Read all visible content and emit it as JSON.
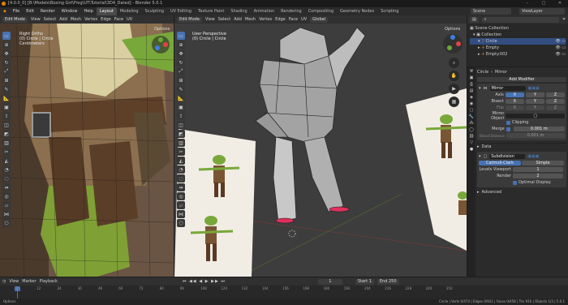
{
  "window": {
    "title": "[4.0.0_0] [B:\\Models\\Boxing Girl\\Frog\\UT\\Tutorial\\3D4_Dated] - Blender 5.0.1",
    "minimize": "–",
    "maximize": "□",
    "close": "✕"
  },
  "menu": [
    "File",
    "Edit",
    "Render",
    "Window",
    "Help"
  ],
  "workspaces": [
    "Layout",
    "Modeling",
    "Sculpting",
    "UV Editing",
    "Texture Paint",
    "Shading",
    "Animation",
    "Rendering",
    "Compositing",
    "Geometry Nodes",
    "Scripting"
  ],
  "active_workspace": "Layout",
  "scene": {
    "label": "Scene",
    "viewlayer": "ViewLayer"
  },
  "left_viewport": {
    "mode": "Edit Mode",
    "menus": [
      "View",
      "Select",
      "Add",
      "Mesh",
      "Vertex",
      "Edge",
      "Face",
      "UV"
    ],
    "overlay_lines": [
      "Right Ortho",
      "(0) Circle | Circle",
      "Centimeters"
    ],
    "options": "Options"
  },
  "right_viewport": {
    "mode": "Edit Mode",
    "menus": [
      "View",
      "Select",
      "Add",
      "Mesh",
      "Vertex",
      "Edge",
      "Face",
      "UV"
    ],
    "overlay_lines": [
      "User Perspective",
      "(0) Circle | Circle"
    ],
    "transform": "Global",
    "options": "Options"
  },
  "outliner": {
    "root": "Scene Collection",
    "items": [
      {
        "name": "Collection",
        "active": false
      },
      {
        "name": "Circle",
        "active": true
      },
      {
        "name": "Empty",
        "active": false
      },
      {
        "name": "Empty.002",
        "active": false
      }
    ]
  },
  "properties": {
    "object": "Circle",
    "modifier_path": "Mirror",
    "add_modifier": "Add Modifier",
    "mirror": {
      "name": "Mirror",
      "axis_label": "Axis",
      "bisect_label": "Bisect",
      "flip_label": "Flip",
      "axes": [
        "X",
        "Y",
        "Z"
      ],
      "mirror_object_label": "Mirror Object",
      "clipping": "Clipping",
      "merge_label": "Merge",
      "merge_value": "0.001 m",
      "bisect_distance_label": "Bisect Distance",
      "bisect_distance": "0.001 m"
    },
    "data_section": "Data",
    "subsurf": {
      "name": "Subdivision",
      "catmull": "Catmull-Clark",
      "simple": "Simple",
      "levels_label": "Levels Viewport",
      "levels": "1",
      "render_label": "Render",
      "render": "2",
      "optimal": "Optimal Display"
    },
    "advanced": "Advanced"
  },
  "timeline": {
    "menus": [
      "View",
      "Marker",
      "Playback"
    ],
    "current_frame": "1",
    "start_label": "Start",
    "start": "1",
    "end_label": "End",
    "end": "250",
    "ticks": [
      "0",
      "12",
      "24",
      "36",
      "48",
      "60",
      "72",
      "84",
      "96",
      "108",
      "120",
      "132",
      "144",
      "156",
      "168",
      "180",
      "192",
      "204",
      "216",
      "228",
      "240",
      "250"
    ]
  },
  "status": {
    "left": "Options",
    "right": "Circle | Verts 0/474 | Edges 0/931 | Faces 0/458 | Tris 916 | Objects 1/3 | 5.0.1"
  },
  "colors": {
    "accent": "#4772b3",
    "orange": "#e87d0d",
    "bg": "#3d3d3d"
  }
}
